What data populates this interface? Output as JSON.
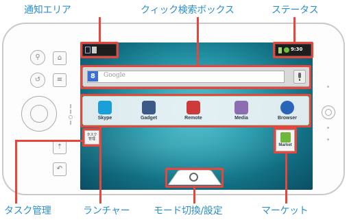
{
  "callouts": {
    "notification_area": "通知エリア",
    "quick_search_box": "クィック検索ボックス",
    "status": "ステータス",
    "task_manager": "タスク管理",
    "launcher": "ランチャー",
    "mode_switch": "モード切換/設定",
    "market": "マーケット"
  },
  "status_bar": {
    "time": "9:30"
  },
  "search": {
    "placeholder": "Google",
    "logo_letter": "8"
  },
  "launcher": {
    "apps": [
      {
        "label": "Skype",
        "icon": "skype-icon",
        "color": "#1aa0d8"
      },
      {
        "label": "Gadget",
        "icon": "gadget-icon",
        "color": "#3b5a8a"
      },
      {
        "label": "Remote",
        "icon": "remote-icon",
        "color": "#cc3a3a"
      },
      {
        "label": "Media",
        "icon": "media-icon",
        "color": "#8c6db0"
      },
      {
        "label": "Browser",
        "icon": "browser-globe-icon",
        "color": "#2a66b8"
      }
    ]
  },
  "task_manager": {
    "line1": "タスク",
    "line2": "管理"
  },
  "market": {
    "label": "Market"
  },
  "colors": {
    "accent": "#e8453c",
    "callout_text": "#2b8fc9"
  }
}
